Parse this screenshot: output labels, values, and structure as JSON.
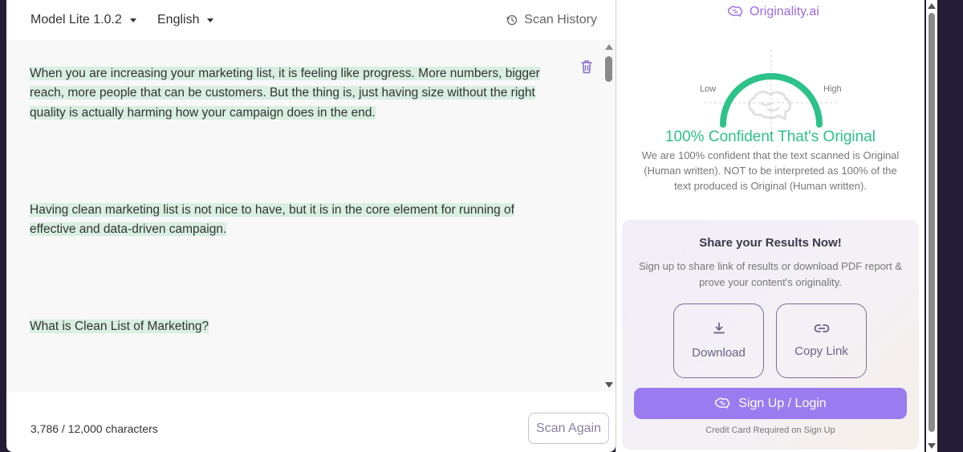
{
  "topbar": {
    "model_label": "Model Lite 1.0.2",
    "language_label": "English",
    "scan_history_label": "Scan History"
  },
  "editor": {
    "paragraphs": [
      "When you are increasing your marketing list, it is feeling like progress. More numbers, bigger reach, more people that can be customers. But the thing is, just having size without the right quality is actually harming how your campaign does in the end.",
      "Having clean marketing list is not nice to have, but it is in the core element for running of effective and data-driven campaign.",
      "What is Clean List of Marketing?"
    ]
  },
  "footer": {
    "char_count": "3,786 / 12,000 characters",
    "scan_again_label": "Scan Again"
  },
  "results": {
    "brand": "Originality.ai",
    "gauge_low": "Low",
    "gauge_high": "High",
    "confidence_title": "100% Confident That's Original",
    "confidence_desc": "We are 100% confident that the text scanned is Original (Human written). NOT to be interpreted as 100% of the text produced is Original (Human written).",
    "confidence_percent": 100
  },
  "share": {
    "title": "Share your Results Now!",
    "desc": "Sign up to share link of results or download PDF report & prove your content's originality.",
    "download_label": "Download",
    "copy_link_label": "Copy Link",
    "signup_label": "Sign Up / Login",
    "credit_note": "Credit Card Required on Sign Up"
  },
  "colors": {
    "accent_purple": "#9a7bf0",
    "brand_purple": "#9a6be0",
    "highlight_green": "#d8efe2",
    "confidence_green": "#2cc28a"
  }
}
